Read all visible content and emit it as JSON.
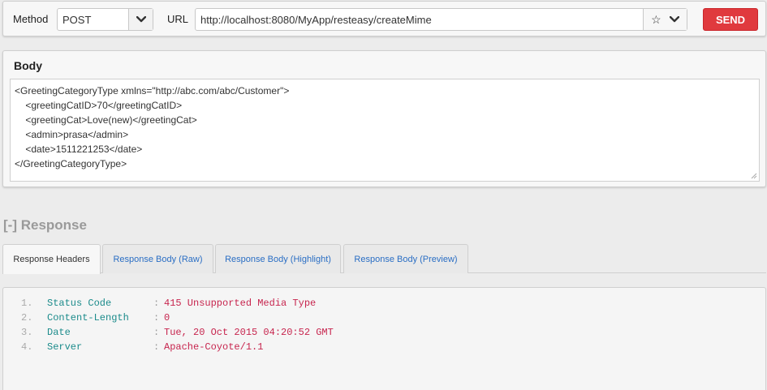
{
  "request": {
    "method_label": "Method",
    "method_value": "POST",
    "url_label": "URL",
    "url_value": "http://localhost:8080/MyApp/resteasy/createMime",
    "send_label": "SEND",
    "icons": {
      "method_caret": "chevron-down-icon",
      "star": "star-icon",
      "url_caret": "chevron-down-icon"
    }
  },
  "body": {
    "title": "Body",
    "lines": [
      "<GreetingCategoryType xmlns=\"http://abc.com/abc/Customer\">",
      "    <greetingCatID>70</greetingCatID>",
      "    <greetingCat>Love(new)</greetingCat>",
      "    <admin>prasa</admin>",
      "    <date>1511221253</date>",
      "</GreetingCategoryType>"
    ]
  },
  "response": {
    "title": "[-] Response",
    "tabs": [
      {
        "label": "Response Headers",
        "active": true
      },
      {
        "label": "Response Body (Raw)",
        "active": false
      },
      {
        "label": "Response Body (Highlight)",
        "active": false
      },
      {
        "label": "Response Body (Preview)",
        "active": false
      }
    ],
    "headers": [
      {
        "num": "1.",
        "key": "Status Code",
        "sep": ":",
        "value": "415 Unsupported Media Type"
      },
      {
        "num": "2.",
        "key": "Content-Length",
        "sep": ":",
        "value": "0"
      },
      {
        "num": "3.",
        "key": "Date",
        "sep": ":",
        "value": "Tue, 20 Oct 2015 04:20:52 GMT"
      },
      {
        "num": "4.",
        "key": "Server",
        "sep": ":",
        "value": "Apache-Coyote/1.1"
      }
    ]
  },
  "colors": {
    "send_button": "#e03a3e",
    "tab_link": "#2a6ec4",
    "header_key": "#1b8b8b",
    "header_value": "#c7254e"
  }
}
